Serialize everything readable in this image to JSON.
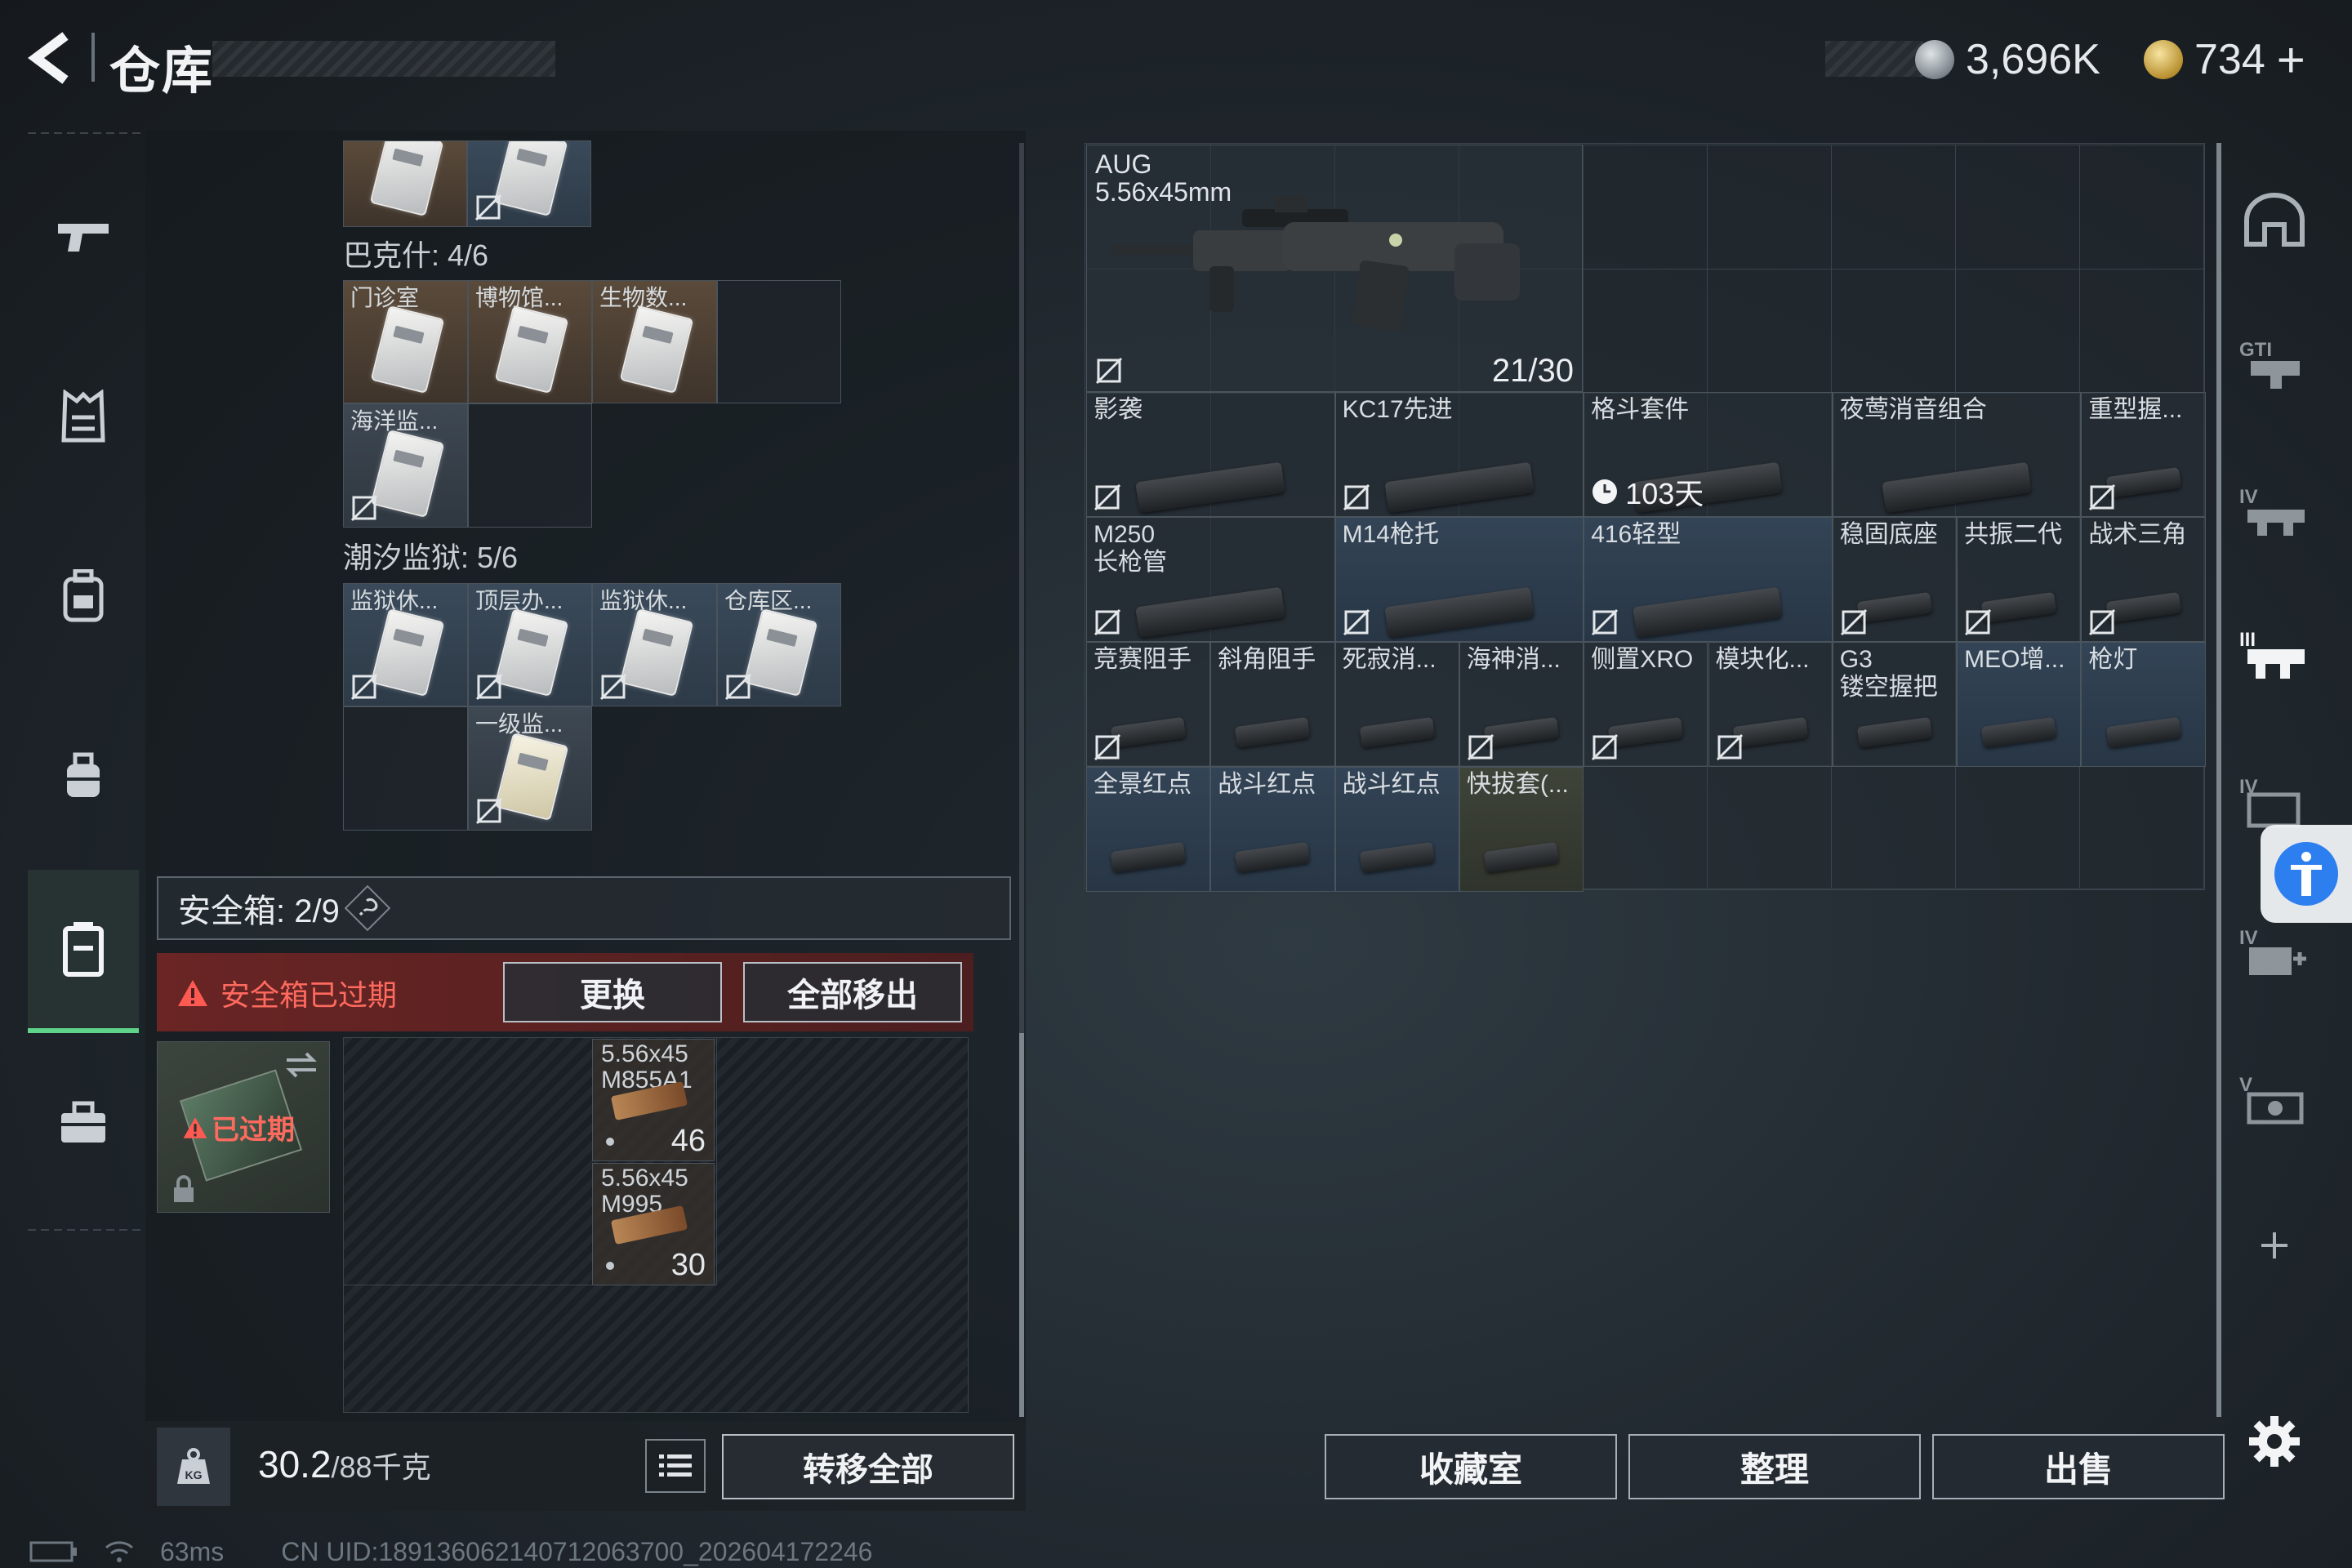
{
  "header": {
    "title": "仓库",
    "currency_1": "3,696K",
    "currency_2": "734",
    "currency_add": "+"
  },
  "left_panel": {
    "section_1": "巴克什: 4/6",
    "section_1_items": [
      "门诊室",
      "博物馆...",
      "生物数...",
      "海洋监..."
    ],
    "section_2": "潮汐监狱: 5/6",
    "section_2_items": [
      "监狱休...",
      "顶层办...",
      "监狱休...",
      "仓库区...",
      "一级监..."
    ],
    "safe_box_label": "安全箱: 2/9",
    "safe_box_help": "?",
    "safe_expired_warning": "安全箱已过期",
    "replace_button": "更换",
    "remove_all_button": "全部移出",
    "expired_badge": "已过期",
    "ammo": [
      {
        "name": "5.56x45\nM855A1",
        "count": "46"
      },
      {
        "name": "5.56x45\nM995",
        "count": "30"
      }
    ],
    "weight_value": "30.2",
    "weight_max": "/88千克",
    "transfer_all_button": "转移全部"
  },
  "right_panel": {
    "weapon": {
      "name": "AUG",
      "caliber": "5.56x45mm",
      "ammo": "21/30"
    },
    "parts": [
      {
        "label": "影袭",
        "lock": true,
        "style": ""
      },
      {
        "label": "KC17先进",
        "lock": true,
        "style": ""
      },
      {
        "label": "格斗套件",
        "lock": false,
        "style": "",
        "timer": "103天"
      },
      {
        "label": "夜莺消音组合",
        "lock": false,
        "style": ""
      },
      {
        "label": "重型握...",
        "lock": true,
        "style": ""
      },
      {
        "label": "M250\n长枪管",
        "lock": true,
        "style": ""
      },
      {
        "label": "M14枪托",
        "lock": true,
        "style": "blue"
      },
      {
        "label": "416轻型",
        "lock": true,
        "style": "blue"
      },
      {
        "label": "稳固底座",
        "lock": true,
        "style": ""
      },
      {
        "label": "共振二代",
        "lock": true,
        "style": ""
      },
      {
        "label": "战术三角",
        "lock": true,
        "style": ""
      },
      {
        "label": "竞赛阻手",
        "lock": true,
        "style": ""
      },
      {
        "label": "斜角阻手",
        "lock": false,
        "style": ""
      },
      {
        "label": "死寂消...",
        "lock": false,
        "style": ""
      },
      {
        "label": "海神消...",
        "lock": true,
        "style": ""
      },
      {
        "label": "侧置XRO",
        "lock": true,
        "style": ""
      },
      {
        "label": "模块化...",
        "lock": true,
        "style": ""
      },
      {
        "label": "G3\n镂空握把",
        "lock": false,
        "style": ""
      },
      {
        "label": "MEO增...",
        "lock": false,
        "style": "blue"
      },
      {
        "label": "枪灯",
        "lock": false,
        "style": "blue"
      },
      {
        "label": "全景红点",
        "lock": false,
        "style": "blue"
      },
      {
        "label": "战斗红点",
        "lock": false,
        "style": "blue"
      },
      {
        "label": "战斗红点",
        "lock": false,
        "style": "blue"
      },
      {
        "label": "快拔套(...",
        "lock": false,
        "style": "tan"
      }
    ],
    "buttons": {
      "collection": "收藏室",
      "organize": "整理",
      "sell": "出售"
    }
  },
  "status_bar": {
    "ping": "63ms",
    "uid": "CN UID:18913606214071206370​0_202604172246"
  }
}
